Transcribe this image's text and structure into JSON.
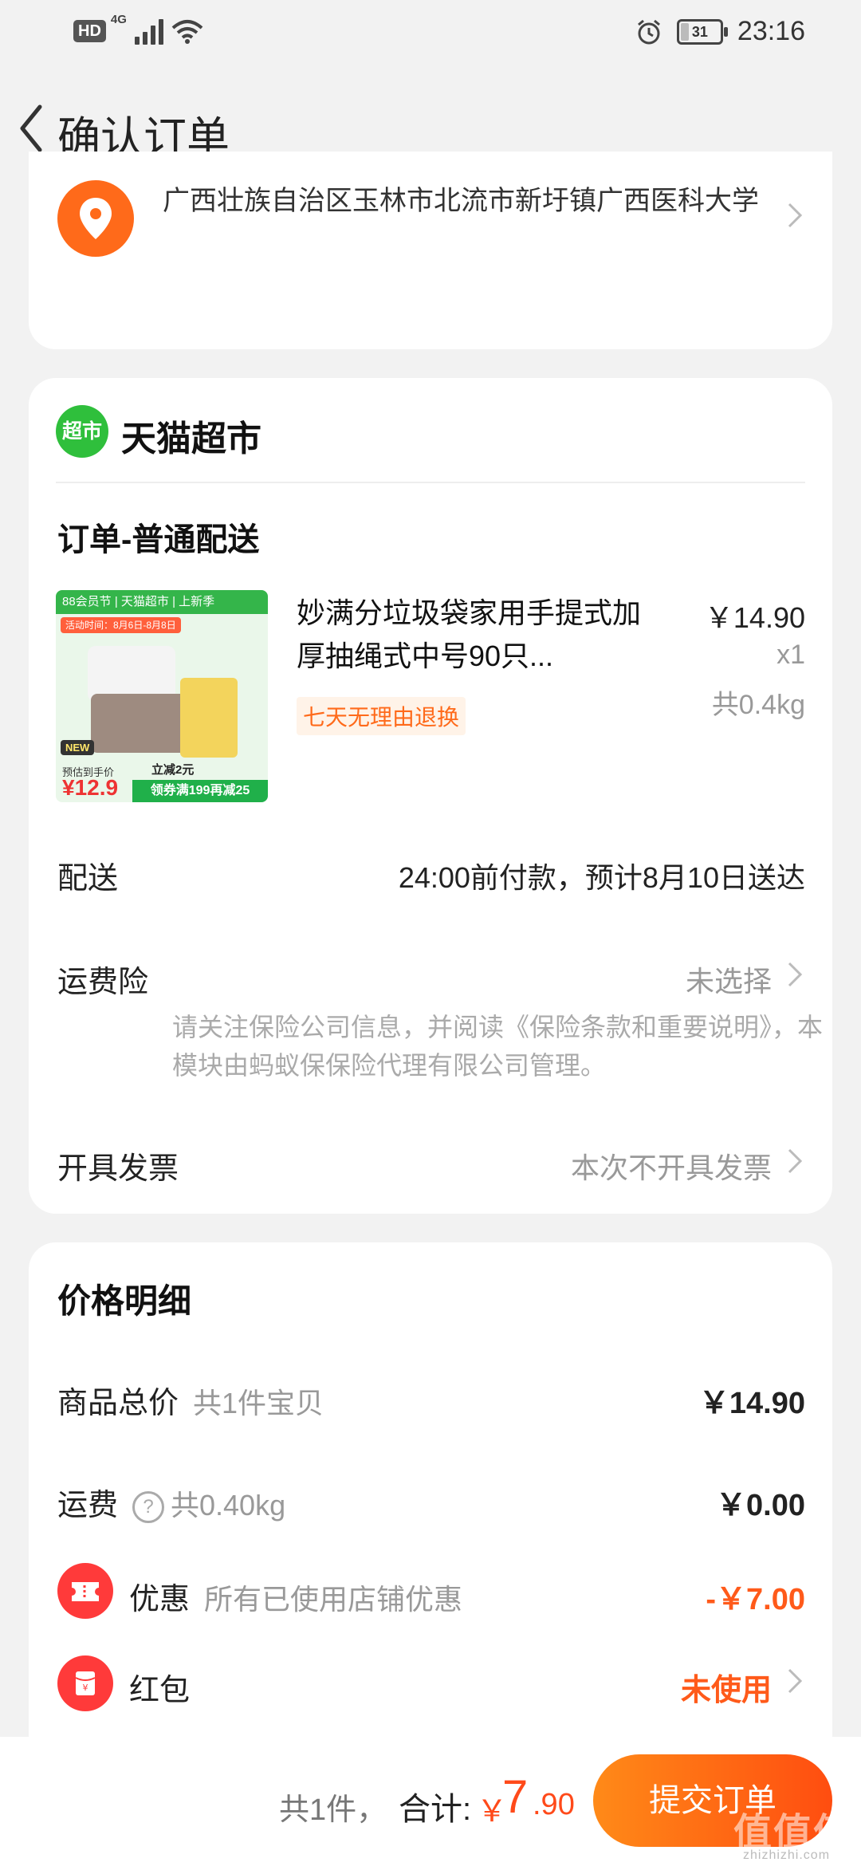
{
  "status_bar": {
    "network_badge": "HD",
    "network_type": "4G",
    "battery_level": "31",
    "time": "23:16"
  },
  "nav": {
    "title": "确认订单"
  },
  "address": {
    "text": "广西壮族自治区玉林市北流市新圩镇广西医科大学"
  },
  "shop": {
    "logo_text": "超市",
    "name": "天猫超市"
  },
  "order": {
    "section_title": "订单-普通配送",
    "product": {
      "title": "妙满分垃圾袋家用手提式加厚抽绳式中号90只...",
      "tag": "七天无理由退换",
      "price": "￥14.90",
      "quantity": "x1",
      "weight": "共0.4kg",
      "image": {
        "top_banner": "88会员节 | 天猫超市 | 上新季",
        "date_badge": "活动时间：8月6日-8月8日",
        "new_badge": "NEW",
        "price_label": "预估到手价",
        "price": "¥12.9",
        "discount": "立减2元",
        "coupon": "领券满199再减25"
      }
    },
    "delivery": {
      "label": "配送",
      "value": "24:00前付款，预计8月10日送达"
    },
    "insurance": {
      "label": "运费险",
      "value": "未选择",
      "note": "请关注保险公司信息，并阅读《保险条款和重要说明》，本模块由蚂蚁保保险代理有限公司管理。"
    },
    "invoice": {
      "label": "开具发票",
      "value": "本次不开具发票"
    }
  },
  "price_detail": {
    "title": "价格明细",
    "goods_total": {
      "label": "商品总价",
      "sub": "共1件宝贝",
      "value": "￥14.90"
    },
    "shipping": {
      "label": "运费",
      "sub": "共0.40kg",
      "value": "￥0.00"
    },
    "discount": {
      "label": "优惠",
      "sub": "所有已使用店铺优惠",
      "value": "-￥7.00"
    },
    "red_packet": {
      "label": "红包",
      "value": "未使用"
    }
  },
  "bottom_bar": {
    "count": "共1件，",
    "total_label": "合计:",
    "currency": "￥",
    "total_int": "7",
    "total_dec": ".90",
    "submit_label": "提交订单",
    "watermark": "值值值",
    "watermark_sub": "zhizhizhi.com"
  },
  "colors": {
    "accent": "#ff5a1a",
    "shop_green": "#2fbf3c",
    "background": "#f2f2f2",
    "red_icon": "#ff3a3a"
  }
}
